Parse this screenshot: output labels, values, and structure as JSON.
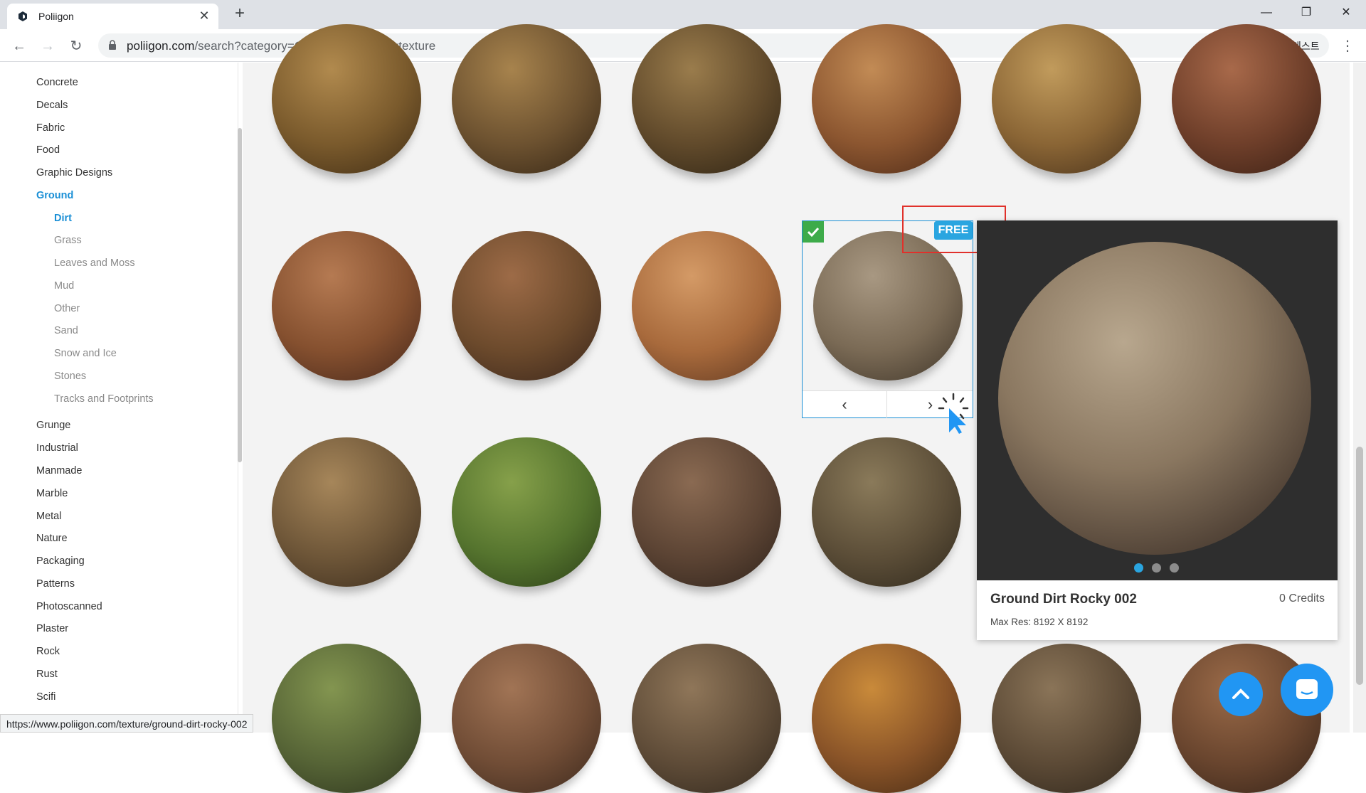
{
  "browser": {
    "tab_title": "Poliigon",
    "url_host": "poliigon.com",
    "url_path": "/search?category=Ground~Dirt&type=texture",
    "profile_label": "게스트",
    "status_url": "https://www.poliigon.com/texture/ground-dirt-rocky-002"
  },
  "sidebar": {
    "categories_top": [
      "Concrete",
      "Decals",
      "Fabric",
      "Food",
      "Graphic Designs",
      "Ground"
    ],
    "active_category": "Ground",
    "subcategories": [
      "Dirt",
      "Grass",
      "Leaves and Moss",
      "Mud",
      "Other",
      "Sand",
      "Snow and Ice",
      "Stones",
      "Tracks and Footprints"
    ],
    "active_subcategory": "Dirt",
    "categories_bottom": [
      "Grunge",
      "Industrial",
      "Manmade",
      "Marble",
      "Metal",
      "Nature",
      "Packaging",
      "Patterns",
      "Photoscanned",
      "Plaster",
      "Rock",
      "Rust",
      "Scifi"
    ]
  },
  "selected_card": {
    "badge": "FREE",
    "prev_icon": "chevron-left-icon",
    "next_icon": "chevron-right-icon"
  },
  "preview": {
    "title": "Ground Dirt Rocky 002",
    "credits": "0 Credits",
    "max_res": "Max Res: 8192 X 8192",
    "slides": 3,
    "active_slide": 1
  },
  "colors": {
    "accent": "#1a8fd6",
    "badge": "#2aa5e0",
    "check": "#3dab4a",
    "highlight": "#e0312b",
    "fab": "#2196f3"
  }
}
